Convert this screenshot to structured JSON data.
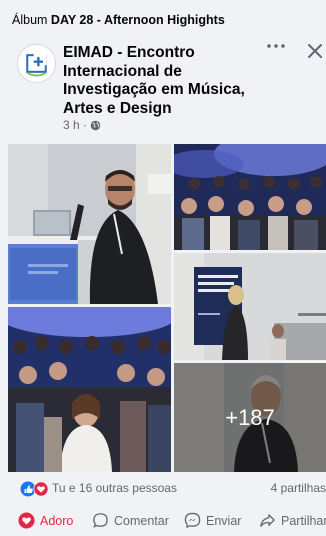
{
  "album": {
    "prefix": "Álbum",
    "title": "DAY 28 - Afternoon Highights"
  },
  "post": {
    "page_name": "EIMAD - Encontro Internacional de Investigação em Música, Artes e Design",
    "time": "3 h ·"
  },
  "photos": {
    "more_count": "+187"
  },
  "reactions": {
    "text": "Tu e 16 outras pessoas",
    "shares": "4 partilhas"
  },
  "actions": {
    "love": "Adoro",
    "comment": "Comentar",
    "send": "Enviar",
    "share": "Partilhar"
  },
  "colors": {
    "love": "#e42645",
    "like": "#1877f2",
    "muted": "#65676b"
  }
}
